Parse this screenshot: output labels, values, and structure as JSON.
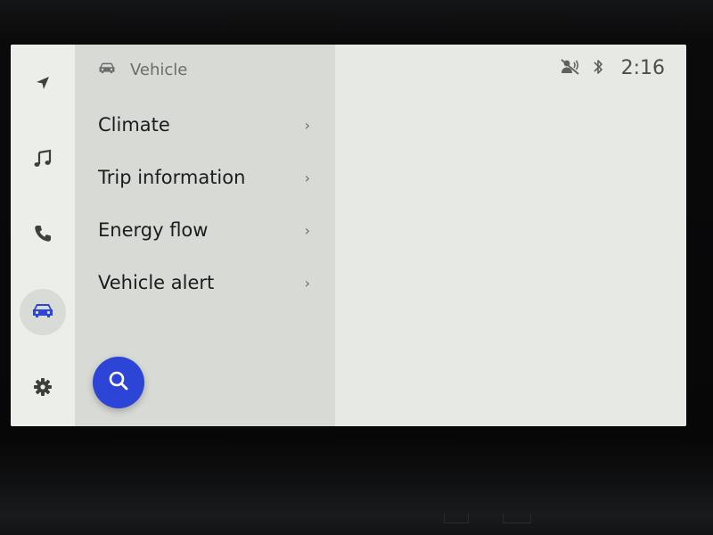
{
  "status_bar": {
    "time": "2:16",
    "icons": [
      "voice-muted-icon",
      "bluetooth-icon"
    ]
  },
  "rail": {
    "items": [
      {
        "name": "navigation",
        "icon": "navigation-arrow-icon",
        "active": false
      },
      {
        "name": "music",
        "icon": "music-note-icon",
        "active": false
      },
      {
        "name": "phone",
        "icon": "phone-icon",
        "active": false
      },
      {
        "name": "vehicle",
        "icon": "car-icon",
        "active": true
      },
      {
        "name": "settings",
        "icon": "gear-icon",
        "active": false
      }
    ]
  },
  "menu": {
    "header": "Vehicle",
    "items": [
      {
        "label": "Climate"
      },
      {
        "label": "Trip information"
      },
      {
        "label": "Energy flow"
      },
      {
        "label": "Vehicle alert"
      }
    ]
  },
  "search_button": {
    "icon": "search-icon"
  },
  "colors": {
    "accent": "#2d45d6",
    "screen_bg": "#e7e9e4",
    "menu_bg": "#d8dad5",
    "rail_bg": "#eceee9",
    "text_primary": "#1b1c1c",
    "text_secondary": "#6b6d6a"
  }
}
